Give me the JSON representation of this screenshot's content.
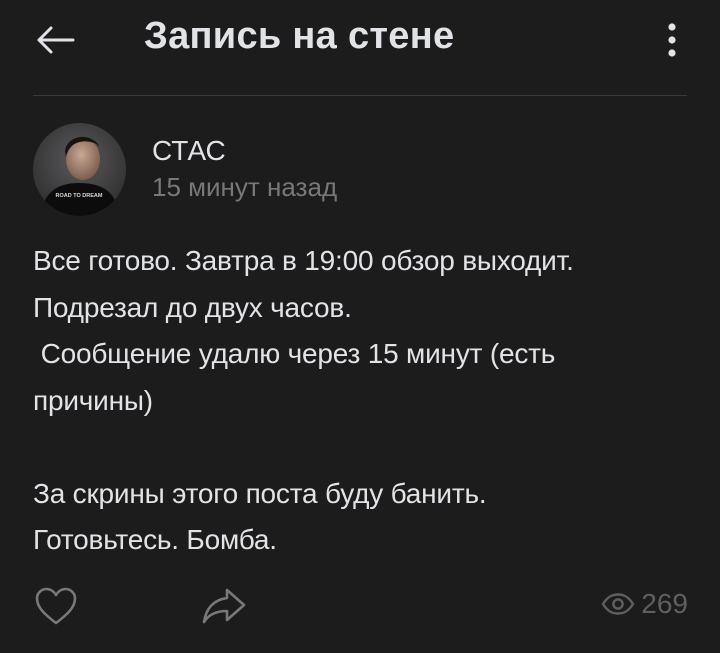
{
  "header": {
    "title": "Запись на стене",
    "back_icon": "arrow-left-icon",
    "menu_icon": "more-vertical-icon"
  },
  "post": {
    "author": {
      "name": "СТАС",
      "avatar_shirt_text": "ROAD TO DREAM"
    },
    "time": "15 минут назад",
    "lines": [
      "Все готово. Завтра в 19:00 обзор выходит.",
      "Подрезал до двух часов.",
      " Сообщение удалю через 15 минут (есть",
      "причины)",
      "",
      "За скрины этого поста буду банить.",
      "Готовьтесь. Бомба."
    ]
  },
  "footer": {
    "like_icon": "heart-icon",
    "share_icon": "share-arrow-icon",
    "views_icon": "eye-icon",
    "views_count": "269"
  },
  "colors": {
    "background": "#1c1c1d",
    "text_primary": "#e1e3e6",
    "text_secondary": "#76787a",
    "icon_muted": "#5d5f61",
    "divider": "#3a3a3c"
  }
}
